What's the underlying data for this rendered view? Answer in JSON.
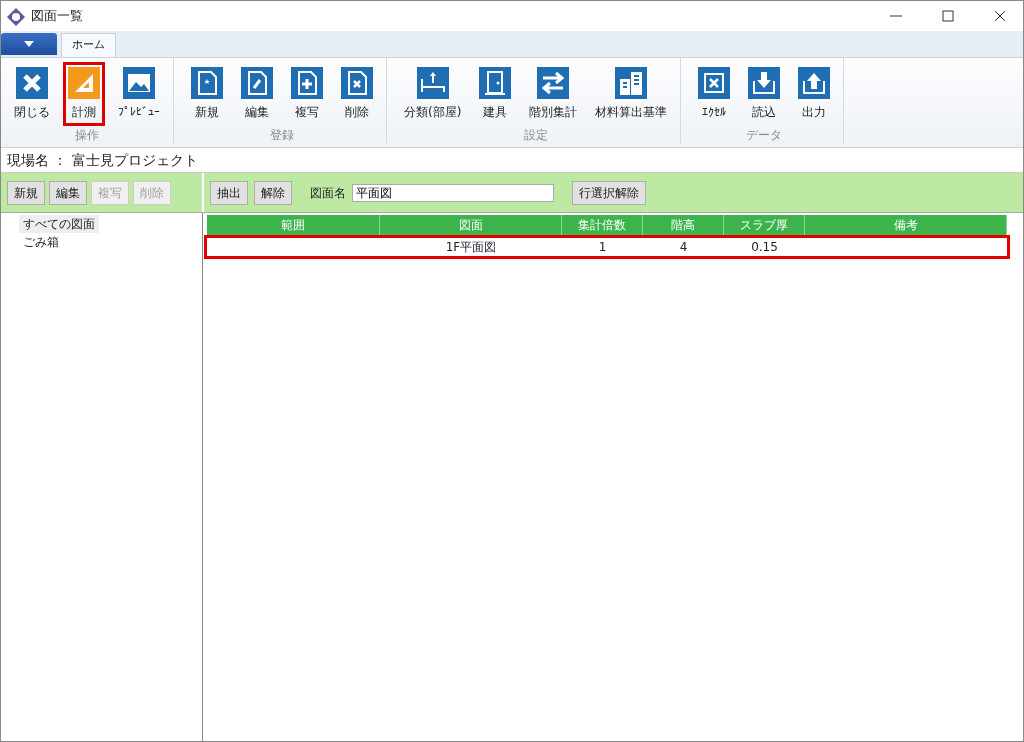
{
  "window": {
    "title": "図面一覧"
  },
  "ribbon_tabs": [
    {
      "label": "ホーム",
      "selected": true
    }
  ],
  "ribbon_groups": [
    {
      "label": "操作",
      "buttons": [
        {
          "label": "閉じる",
          "selected": false,
          "annotated": false
        },
        {
          "label": "計測",
          "selected": true,
          "annotated": true
        },
        {
          "label": "ﾌﾟﾚﾋﾞｭｰ",
          "selected": false,
          "annotated": false
        }
      ]
    },
    {
      "label": "登録",
      "buttons": [
        {
          "label": "新規",
          "selected": false,
          "annotated": false
        },
        {
          "label": "編集",
          "selected": false,
          "annotated": false
        },
        {
          "label": "複写",
          "selected": false,
          "annotated": false
        },
        {
          "label": "削除",
          "selected": false,
          "annotated": false
        }
      ]
    },
    {
      "label": "設定",
      "buttons": [
        {
          "label": "分類(部屋)",
          "selected": false,
          "annotated": false
        },
        {
          "label": "建具",
          "selected": false,
          "annotated": false
        },
        {
          "label": "階別集計",
          "selected": false,
          "annotated": false
        },
        {
          "label": "材料算出基準",
          "selected": false,
          "annotated": false
        }
      ]
    },
    {
      "label": "データ",
      "buttons": [
        {
          "label": "ｴｸｾﾙ",
          "selected": false,
          "annotated": false
        },
        {
          "label": "読込",
          "selected": false,
          "annotated": false
        },
        {
          "label": "出力",
          "selected": false,
          "annotated": false
        }
      ]
    }
  ],
  "site": {
    "label": "現場名 ： 富士見プロジェクト"
  },
  "left_toolbar": [
    {
      "label": "新規",
      "disabled": false
    },
    {
      "label": "編集",
      "disabled": false
    },
    {
      "label": "複写",
      "disabled": true
    },
    {
      "label": "削除",
      "disabled": true
    }
  ],
  "right_toolbar": {
    "buttons": [
      {
        "label": "抽出"
      },
      {
        "label": "解除"
      }
    ],
    "filter_label": "図面名",
    "filter_value": "平面図",
    "clear_button": "行選択解除"
  },
  "tree": [
    {
      "label": "すべての図面",
      "selected": true
    },
    {
      "label": "ごみ箱",
      "selected": false
    }
  ],
  "table": {
    "columns": [
      "範囲",
      "図面",
      "集計倍数",
      "階高",
      "スラブ厚",
      "備考"
    ],
    "rows": [
      {
        "cells": [
          "",
          "1F平面図",
          "1",
          "4",
          "0.15",
          ""
        ],
        "annotated": true
      }
    ]
  }
}
